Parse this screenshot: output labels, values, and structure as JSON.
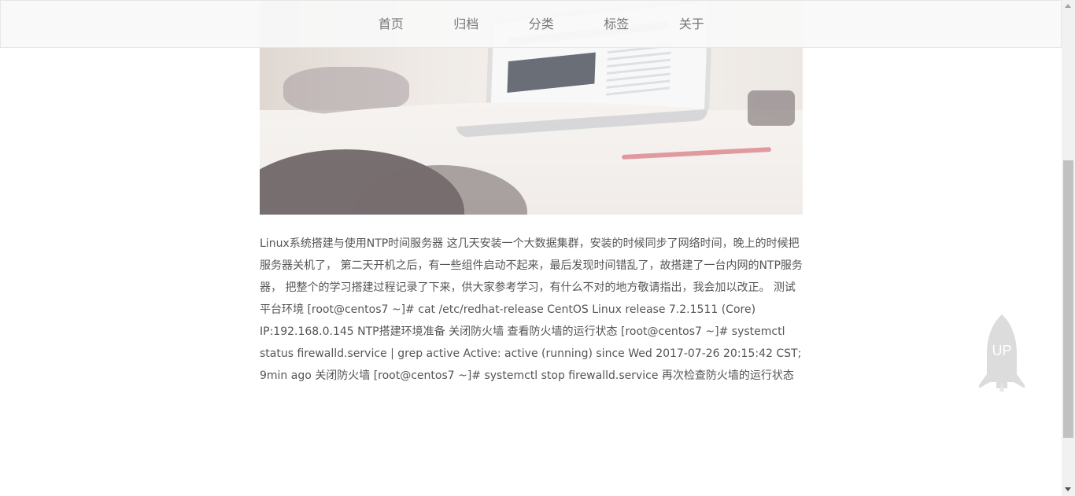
{
  "nav": {
    "items": [
      {
        "label": "首页"
      },
      {
        "label": "归档"
      },
      {
        "label": "分类"
      },
      {
        "label": "标签"
      },
      {
        "label": "关于"
      }
    ]
  },
  "hero": {
    "image_subject": "laptop-on-desk-photo"
  },
  "post": {
    "excerpt": "Linux系统搭建与使用NTP时间服务器 这几天安装一个大数据集群，安装的时候同步了网络时间，晚上的时候把服务器关机了， 第二天开机之后，有一些组件启动不起来，最后发现时间错乱了，故搭建了一台内网的NTP服务器， 把整个的学习搭建过程记录了下来，供大家参考学习，有什么不对的地方敬请指出，我会加以改正。 测试平台环境 [root@centos7 ~]# cat /etc/redhat-release CentOS Linux release 7.2.1511 (Core) IP:192.168.0.145 NTP搭建环境准备 关闭防火墙 查看防火墙的运行状态 [root@centos7 ~]# systemctl status firewalld.service | grep active Active: active (running) since Wed 2017-07-26 20:15:42 CST; 9min ago 关闭防火墙 [root@centos7 ~]# systemctl stop firewalld.service 再次检查防火墙的运行状态"
  },
  "back_to_top": {
    "label": "UP",
    "icon": "rocket-icon"
  },
  "colors": {
    "nav_bg": "#f8f8f8",
    "nav_text": "#777777",
    "body_text": "#555555",
    "rocket": "#dcdcdc"
  }
}
